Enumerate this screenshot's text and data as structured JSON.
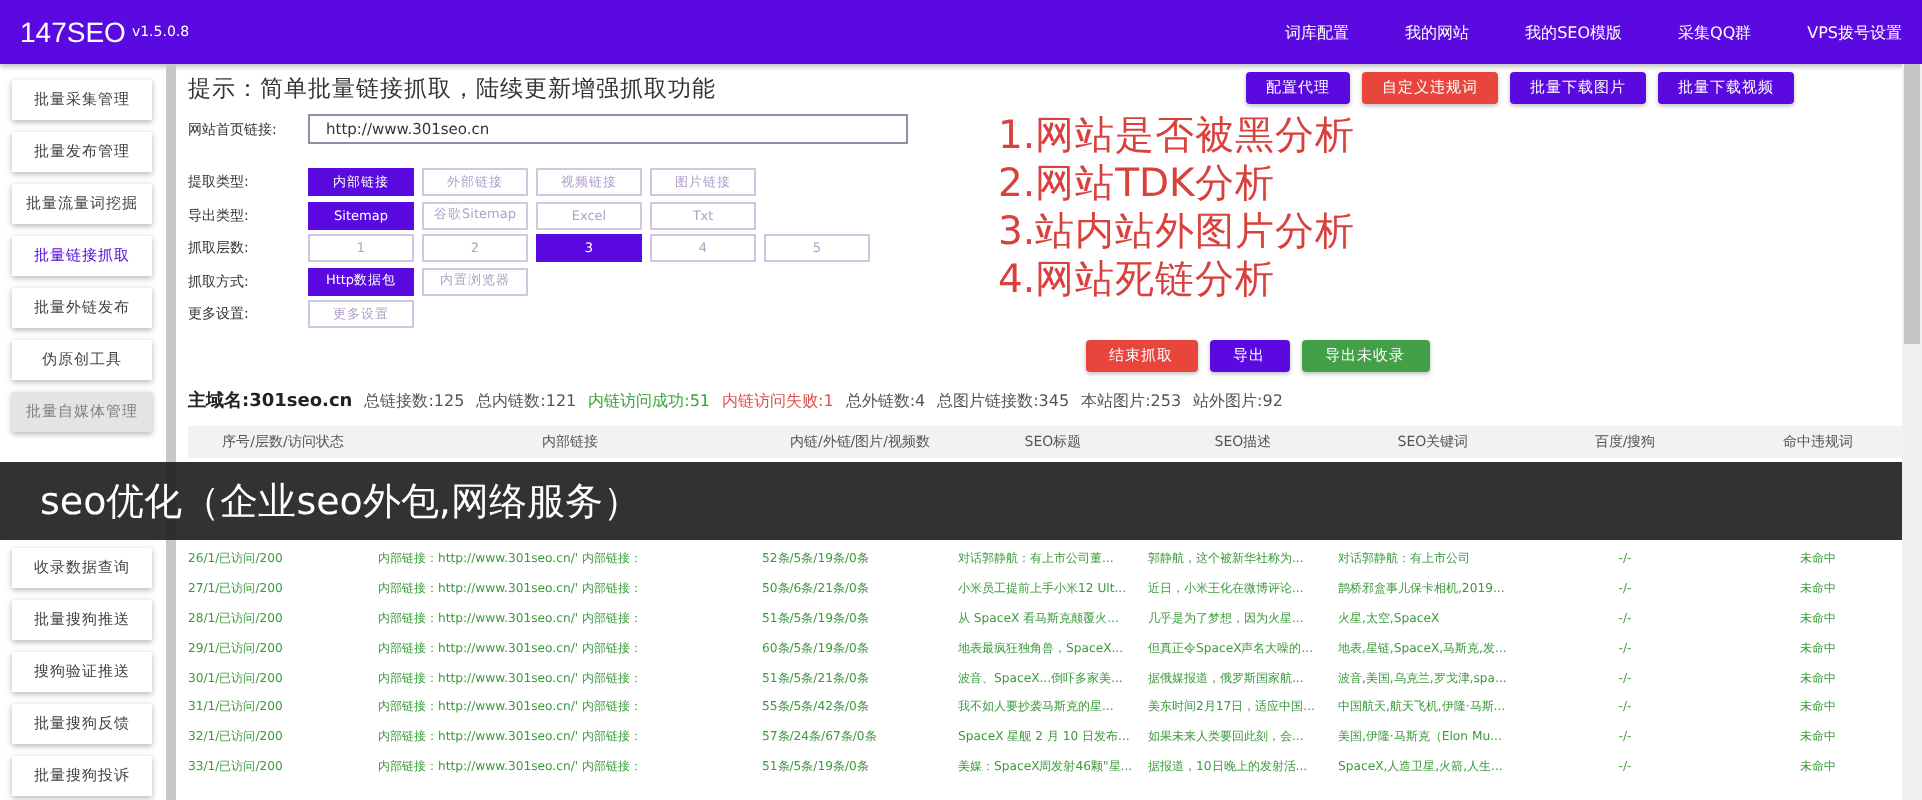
{
  "header": {
    "logo": "147SEO",
    "version": "v1.5.0.8",
    "nav": [
      "词库配置",
      "我的网站",
      "我的SEO模版",
      "采集QQ群",
      "VPS拨号设置"
    ]
  },
  "sidebar": {
    "items": [
      {
        "label": "批量采集管理",
        "selected": false,
        "disabled": false
      },
      {
        "label": "批量发布管理",
        "selected": false,
        "disabled": false
      },
      {
        "label": "批量流量词挖掘",
        "selected": false,
        "disabled": false
      },
      {
        "label": "批量链接抓取",
        "selected": true,
        "disabled": false
      },
      {
        "label": "批量外链发布",
        "selected": false,
        "disabled": false
      },
      {
        "label": "伪原创工具",
        "selected": false,
        "disabled": false
      },
      {
        "label": "批量自媒体管理",
        "selected": false,
        "disabled": true
      }
    ],
    "more_items": [
      {
        "label": "收录数据查询",
        "selected": false,
        "disabled": false
      },
      {
        "label": "批量搜狗推送",
        "selected": false,
        "disabled": false
      },
      {
        "label": "搜狗验证推送",
        "selected": false,
        "disabled": false
      },
      {
        "label": "批量搜狗反馈",
        "selected": false,
        "disabled": false
      },
      {
        "label": "批量搜狗投诉",
        "selected": false,
        "disabled": false
      }
    ]
  },
  "tip": "提示：简单批量链接抓取，陆续更新增强抓取功能",
  "toolbar_buttons": [
    {
      "label": "配置代理",
      "color": "#5a0ae0"
    },
    {
      "label": "自定义违规词",
      "color": "#e8453c"
    },
    {
      "label": "批量下载图片",
      "color": "#5a0ae0"
    },
    {
      "label": "批量下载视频",
      "color": "#5a0ae0"
    }
  ],
  "url_field": {
    "label": "网站首页链接:",
    "value": "http://www.301seo.cn"
  },
  "option_rows": [
    {
      "label": "提取类型:",
      "options": [
        {
          "label": "内部链接",
          "selected": true
        },
        {
          "label": "外部链接",
          "selected": false
        },
        {
          "label": "视频链接",
          "selected": false
        },
        {
          "label": "图片链接",
          "selected": false
        }
      ]
    },
    {
      "label": "导出类型:",
      "options": [
        {
          "label": "Sitemap",
          "selected": true
        },
        {
          "label": "谷歌Sitemap",
          "selected": false
        },
        {
          "label": "Excel",
          "selected": false
        },
        {
          "label": "Txt",
          "selected": false
        }
      ]
    },
    {
      "label": "抓取层数:",
      "options": [
        {
          "label": "1",
          "selected": false
        },
        {
          "label": "2",
          "selected": false
        },
        {
          "label": "3",
          "selected": true
        },
        {
          "label": "4",
          "selected": false
        },
        {
          "label": "5",
          "selected": false
        }
      ]
    },
    {
      "label": "抓取方式:",
      "options": [
        {
          "label": "Http数据包",
          "selected": true
        },
        {
          "label": "内置浏览器",
          "selected": false
        }
      ]
    },
    {
      "label": "更多设置:",
      "options": [
        {
          "label": "更多设置",
          "selected": false
        }
      ]
    }
  ],
  "analysis_list": [
    "1.网站是否被黑分析",
    "2.网站TDK分析",
    "3.站内站外图片分析",
    "4.网站死链分析"
  ],
  "action_buttons": [
    {
      "label": "结束抓取",
      "color": "#e8453c"
    },
    {
      "label": "导出",
      "color": "#5a0ae0"
    },
    {
      "label": "导出未收录",
      "color": "#43a047"
    }
  ],
  "stats": [
    {
      "text": "主域名:301seo.cn",
      "kind": "bold"
    },
    {
      "text": "总链接数:125",
      "kind": "plain"
    },
    {
      "text": "总内链数:121",
      "kind": "plain"
    },
    {
      "text": "内链访问成功:51",
      "kind": "success"
    },
    {
      "text": "内链访问失败:1",
      "kind": "failure"
    },
    {
      "text": "总外链数:4",
      "kind": "plain"
    },
    {
      "text": "总图片链接数:345",
      "kind": "plain"
    },
    {
      "text": "本站图片:253",
      "kind": "plain"
    },
    {
      "text": "站外图片:92",
      "kind": "plain"
    }
  ],
  "table": {
    "columns": [
      "序号/层数/访问状态",
      "内部链接",
      "内链/外链/图片/视频数",
      "SEO标题",
      "SEO描述",
      "SEO关键词",
      "百度/搜狗",
      "命中违规词"
    ],
    "rows": [
      {
        "cells": [
          "26/1/已访问/200",
          "内部链接：http://www.301seo.cn/' 内部链接：",
          "52条/5条/19条/0条",
          "对话郭静航：有上市公司董...",
          "郭静航，这个被新华社称为...",
          "对话郭静航：有上市公司",
          "-/-",
          "未命中"
        ]
      },
      {
        "cells": [
          "27/1/已访问/200",
          "内部链接：http://www.301seo.cn/' 内部链接：",
          "50条/6条/21条/0条",
          "小米员工提前上手小米12 Ult...",
          "近日，小米王化在微博评论...",
          "鹊桥邪盒事儿保卡相机,2019...",
          "-/-",
          "未命中"
        ]
      },
      {
        "cells": [
          "28/1/已访问/200",
          "内部链接：http://www.301seo.cn/' 内部链接：",
          "51条/5条/19条/0条",
          "从 SpaceX 看马斯克颠覆火...",
          "几乎是为了梦想，因为火星...",
          "火星,太空,SpaceX",
          "-/-",
          "未命中"
        ]
      },
      {
        "cells": [
          "29/1/已访问/200",
          "内部链接：http://www.301seo.cn/' 内部链接：",
          "60条/5条/19条/0条",
          "地表最疯狂独角兽，SpaceX...",
          "但真正令SpaceX声名大噪的...",
          "地表,星链,SpaceX,马斯克,发...",
          "-/-",
          "未命中"
        ]
      },
      {
        "cells": [
          "30/1/已访问/200",
          "内部链接：http://www.301seo.cn/' 内部链接：",
          "51条/5条/21条/0条",
          "波音、SpaceX...倒吓多家美...",
          "据俄媒报道，俄罗斯国家航...",
          "波音,美国,乌克兰,罗戈津,spa...",
          "-/-",
          "未命中"
        ]
      },
      {
        "cells": [
          "31/1/已访问/200",
          "内部链接：http://www.301seo.cn/' 内部链接：",
          "55条/5条/42条/0条",
          "我不如人要抄袭马斯克的星...",
          "美东时间2月17日，适应中国...",
          "中国航天,航天飞机,伊隆·马斯...",
          "-/-",
          "未命中"
        ]
      },
      {
        "cells": [
          "32/1/已访问/200",
          "内部链接：http://www.301seo.cn/' 内部链接：",
          "57条/24条/67条/0条",
          "SpaceX 星舰 2 月 10 日发布...",
          "如果未来人类要回此刻，会...",
          "美国,伊隆·马斯克（Elon Mu...",
          "-/-",
          "未命中"
        ]
      },
      {
        "cells": [
          "33/1/已访问/200",
          "内部链接：http://www.301seo.cn/' 内部链接：",
          "51条/5条/19条/0条",
          "美媒：SpaceX周发射46颗\"星...",
          "据报道，10日晚上的发射活...",
          "SpaceX,人造卫星,火箭,人生...",
          "-/-",
          "未命中"
        ]
      }
    ]
  },
  "caption": "seo优化（企业seo外包,网络服务）"
}
